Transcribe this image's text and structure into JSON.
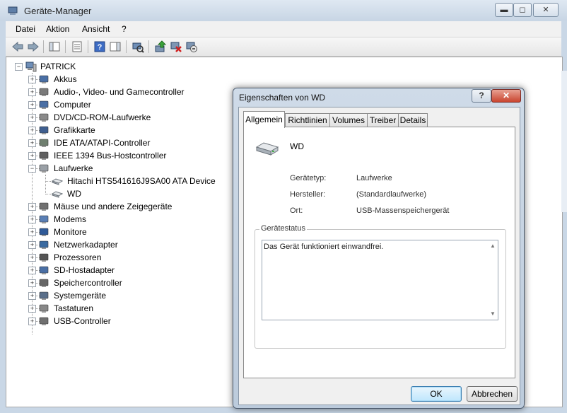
{
  "window": {
    "title": "Geräte-Manager",
    "controls": {
      "minimize": "▬",
      "maximize": "◻",
      "close": "✕"
    }
  },
  "menu": [
    "Datei",
    "Aktion",
    "Ansicht",
    "?"
  ],
  "toolbar_icons": [
    "back-icon",
    "forward-icon",
    "show-hide-tree-icon",
    "properties-icon",
    "help-icon",
    "show-hide-action-pane-icon",
    "scan-hardware-icon",
    "update-driver-icon",
    "uninstall-icon",
    "enable-device-icon"
  ],
  "tree": {
    "root": "PATRICK",
    "items": [
      {
        "label": "Akkus",
        "expander": "+"
      },
      {
        "label": "Audio-, Video- und Gamecontroller",
        "expander": "+"
      },
      {
        "label": "Computer",
        "expander": "+"
      },
      {
        "label": "DVD/CD-ROM-Laufwerke",
        "expander": "+"
      },
      {
        "label": "Grafikkarte",
        "expander": "+"
      },
      {
        "label": "IDE ATA/ATAPI-Controller",
        "expander": "+"
      },
      {
        "label": "IEEE 1394 Bus-Hostcontroller",
        "expander": "+"
      },
      {
        "label": "Laufwerke",
        "expander": "−"
      },
      {
        "label": "Hitachi HTS541616J9SA00 ATA Device",
        "child": true
      },
      {
        "label": "WD",
        "child": true
      },
      {
        "label": "Mäuse und andere Zeigegeräte",
        "expander": "+"
      },
      {
        "label": "Modems",
        "expander": "+"
      },
      {
        "label": "Monitore",
        "expander": "+"
      },
      {
        "label": "Netzwerkadapter",
        "expander": "+"
      },
      {
        "label": "Prozessoren",
        "expander": "+"
      },
      {
        "label": "SD-Hostadapter",
        "expander": "+"
      },
      {
        "label": "Speichercontroller",
        "expander": "+"
      },
      {
        "label": "Systemgeräte",
        "expander": "+"
      },
      {
        "label": "Tastaturen",
        "expander": "+"
      },
      {
        "label": "USB-Controller",
        "expander": "+"
      }
    ]
  },
  "dialog": {
    "title": "Eigenschaften von WD",
    "help": "?",
    "close": "✕",
    "tabs": [
      "Allgemein",
      "Richtlinien",
      "Volumes",
      "Treiber",
      "Details"
    ],
    "device_name": "WD",
    "props": {
      "type_label": "Gerätetyp:",
      "type_value": "Laufwerke",
      "maker_label": "Hersteller:",
      "maker_value": "(Standardlaufwerke)",
      "location_label": "Ort:",
      "location_value": "USB-Massenspeichergerät"
    },
    "status_group": "Gerätestatus",
    "status_text": "Das Gerät funktioniert einwandfrei.",
    "ok": "OK",
    "cancel": "Abbrechen"
  }
}
